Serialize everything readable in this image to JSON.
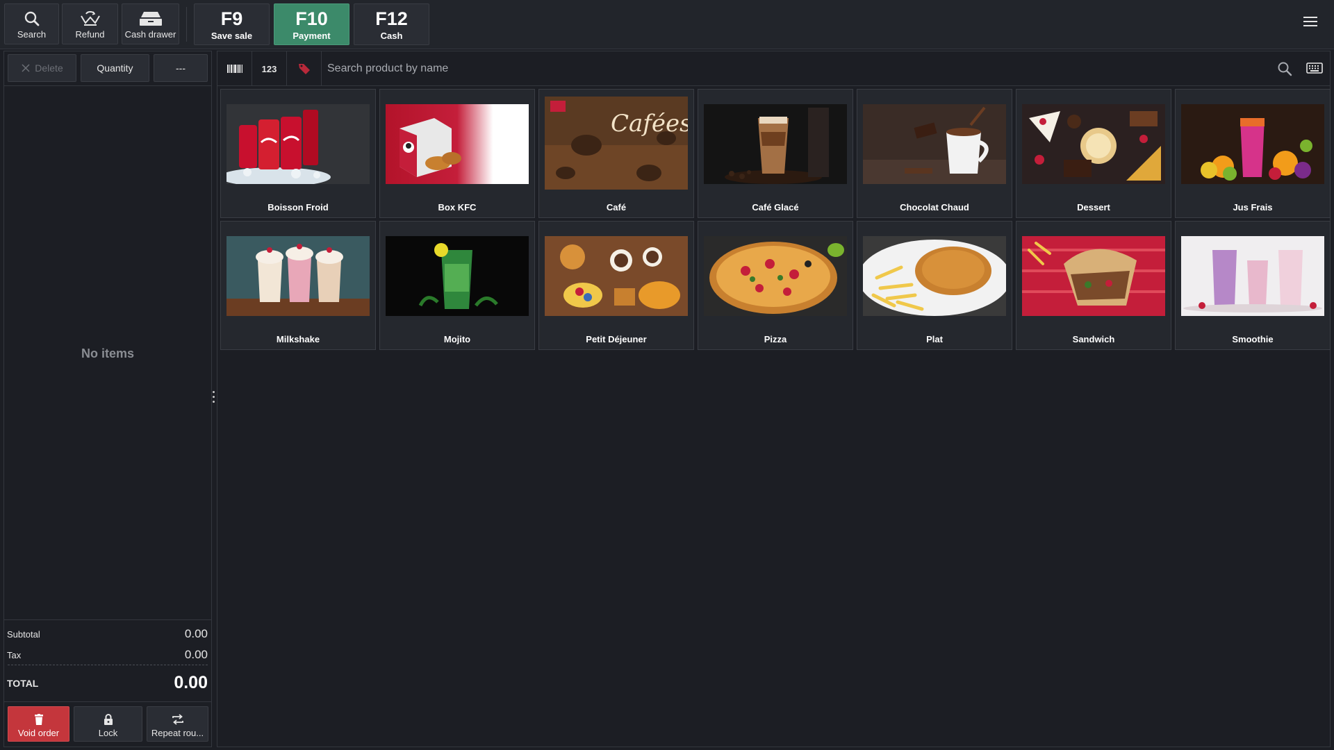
{
  "toolbar": {
    "buttons": [
      {
        "label": "Search",
        "icon": "search-icon"
      },
      {
        "label": "Refund",
        "icon": "refund-icon"
      },
      {
        "label": "Cash drawer",
        "icon": "cash-drawer-icon"
      }
    ],
    "fkeys": [
      {
        "key": "F9",
        "label": "Save sale"
      },
      {
        "key": "F10",
        "label": "Payment"
      },
      {
        "key": "F12",
        "label": "Cash"
      }
    ],
    "menu_icon": "hamburger-menu-icon"
  },
  "order": {
    "actions": {
      "delete": "Delete",
      "quantity": "Quantity",
      "more": "---"
    },
    "empty_text": "No items",
    "subtotal_label": "Subtotal",
    "subtotal_value": "0.00",
    "tax_label": "Tax",
    "tax_value": "0.00",
    "total_label": "TOTAL",
    "total_value": "0.00",
    "bottom": {
      "void": "Void order",
      "lock": "Lock",
      "repeat": "Repeat rou..."
    }
  },
  "search": {
    "barcode_icon": "barcode-icon",
    "numeric_label": "123",
    "tag_icon": "tag-icon",
    "placeholder": "Search product by name",
    "search_icon": "search-icon",
    "keyboard_icon": "keyboard-icon"
  },
  "categories": [
    {
      "name": "Boisson Froid"
    },
    {
      "name": "Box KFC"
    },
    {
      "name": "Café"
    },
    {
      "name": "Café Glacé"
    },
    {
      "name": "Chocolat Chaud"
    },
    {
      "name": "Dessert"
    },
    {
      "name": "Jus Frais"
    },
    {
      "name": "Milkshake"
    },
    {
      "name": "Mojito"
    },
    {
      "name": "Petit Déjeuner"
    },
    {
      "name": "Pizza"
    },
    {
      "name": "Plat"
    },
    {
      "name": "Sandwich"
    },
    {
      "name": "Smoothie"
    }
  ],
  "colors": {
    "accent_green": "#3c8a6a",
    "danger_red": "#c4363c",
    "background": "#1c1e24"
  }
}
